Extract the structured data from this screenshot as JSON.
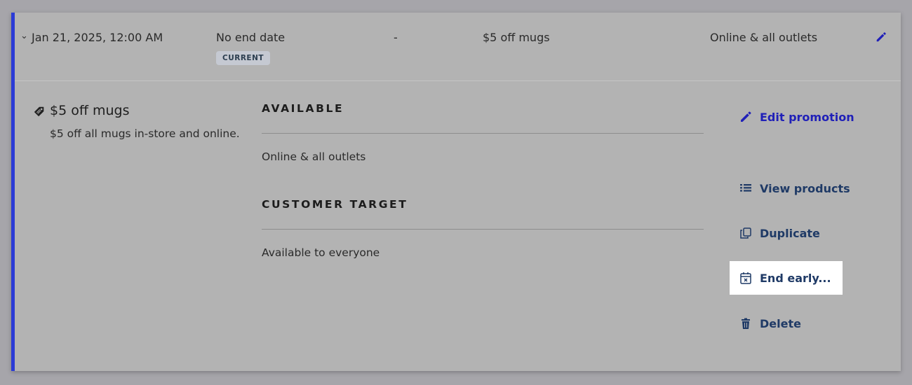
{
  "row": {
    "start": "Jan 21, 2025, 12:00 AM",
    "end": "No end date",
    "badge": "CURRENT",
    "dash": "-",
    "discount": "$5 off mugs",
    "channels": "Online & all outlets"
  },
  "detail": {
    "title": "$5 off mugs",
    "description": "$5 off all mugs in-store and online.",
    "available_heading": "AVAILABLE",
    "available_value": "Online & all outlets",
    "target_heading": "CUSTOMER TARGET",
    "target_value": "Available to everyone"
  },
  "actions": {
    "edit": "Edit promotion",
    "view": "View products",
    "duplicate": "Duplicate",
    "end_early": "End early...",
    "delete": "Delete"
  },
  "colors": {
    "accent_bar": "#2b3bd6",
    "edit_link": "#2020b8",
    "action_text": "#1f3a66",
    "badge_bg": "#c5c9d2"
  },
  "icons": {
    "expand": "chevron-down-icon",
    "row_edit": "pencil-icon",
    "promo": "tag-icon",
    "edit": "pencil-icon",
    "view": "list-icon",
    "duplicate": "duplicate-icon",
    "end_early": "calendar-x-icon",
    "delete": "trash-icon"
  }
}
